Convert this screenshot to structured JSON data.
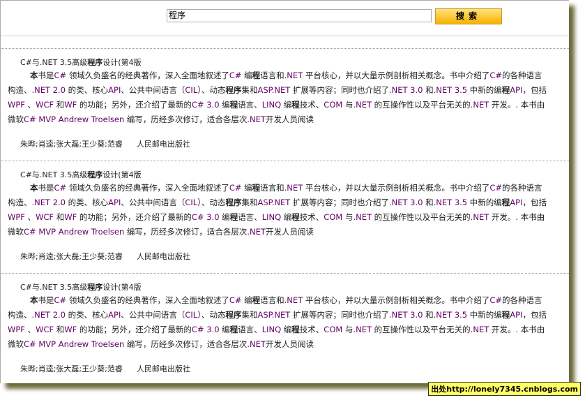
{
  "search": {
    "value": "程序",
    "button": "搜索"
  },
  "records": [
    {
      "title": [
        {
          "t": "C#与.NET 3.5高级"
        },
        {
          "t": "程序",
          "b": 1
        },
        {
          "t": "设计(第4版"
        }
      ],
      "author": "朱晔;肖逵;张大磊;王少葵;范睿",
      "publisher": "人民邮电出版社"
    },
    {
      "title": [
        {
          "t": "C#与.NET 3.5高级"
        },
        {
          "t": "程序",
          "b": 1
        },
        {
          "t": "设计(第4版"
        }
      ],
      "author": "朱晔;肖逵;张大磊;王少葵;范睿",
      "publisher": "人民邮电出版社"
    },
    {
      "title": [
        {
          "t": "C#与.NET 3.5高级"
        },
        {
          "t": "程序",
          "b": 1
        },
        {
          "t": "设计(第4版"
        }
      ],
      "author": "朱晔;肖逵;张大磊;王少葵;范睿",
      "publisher": "人民邮电出版社"
    }
  ],
  "description": [
    {
      "t": "本",
      "b": 1
    },
    {
      "t": "书是"
    },
    {
      "t": "C#",
      "e": 1
    },
    {
      "t": " 领域久负盛名的经典著作，深入全面地叙述了"
    },
    {
      "t": "C#",
      "e": 1
    },
    {
      "t": " 编"
    },
    {
      "t": "程",
      "b": 1
    },
    {
      "t": "语言和"
    },
    {
      "t": ".NET",
      "e": 1
    },
    {
      "t": " 平台核心，并以大量示例剖析相关概念。书中介绍了"
    },
    {
      "t": "C#",
      "e": 1
    },
    {
      "t": "的各种语言构造、"
    },
    {
      "t": ".NET 2.0",
      "e": 1
    },
    {
      "t": " 的类、核心"
    },
    {
      "t": "API",
      "e": 1
    },
    {
      "t": "、公共中间语言（"
    },
    {
      "t": "CIL",
      "e": 1
    },
    {
      "t": "）、动态"
    },
    {
      "t": "程序",
      "b": 1
    },
    {
      "t": "集和"
    },
    {
      "t": "ASP.NET",
      "e": 1
    },
    {
      "t": " 扩展等内容；同时也介绍了"
    },
    {
      "t": ".NET 3.0",
      "e": 1
    },
    {
      "t": " 和"
    },
    {
      "t": ".NET 3.5",
      "e": 1
    },
    {
      "t": " 中新的编"
    },
    {
      "t": "程",
      "b": 1
    },
    {
      "t": "API",
      "e": 1
    },
    {
      "t": "，包括"
    },
    {
      "t": "WPF",
      "e": 1
    },
    {
      "t": " 、"
    },
    {
      "t": "WCF",
      "e": 1
    },
    {
      "t": " 和"
    },
    {
      "t": "WF",
      "e": 1
    },
    {
      "t": " 的功能；另外，还介绍了最新的"
    },
    {
      "t": "C# 3.0",
      "e": 1
    },
    {
      "t": " 编"
    },
    {
      "t": "程",
      "b": 1
    },
    {
      "t": "语言、"
    },
    {
      "t": "LINQ",
      "e": 1
    },
    {
      "t": " 编"
    },
    {
      "t": "程",
      "b": 1
    },
    {
      "t": "技术、"
    },
    {
      "t": "COM",
      "e": 1
    },
    {
      "t": " 与"
    },
    {
      "t": ".NET",
      "e": 1
    },
    {
      "t": " 的互操作性以及平台无关的"
    },
    {
      "t": ".NET",
      "e": 1
    },
    {
      "t": " 开发。. 本书由微软"
    },
    {
      "t": "C# MVP Andrew Troelsen",
      "e": 1
    },
    {
      "t": " 编写，历经多次修订，适合各层次"
    },
    {
      "t": ".NET",
      "e": 1
    },
    {
      "t": "开发人员阅读"
    }
  ],
  "source_label": "出处http://lonely7345.cnblogs.com"
}
